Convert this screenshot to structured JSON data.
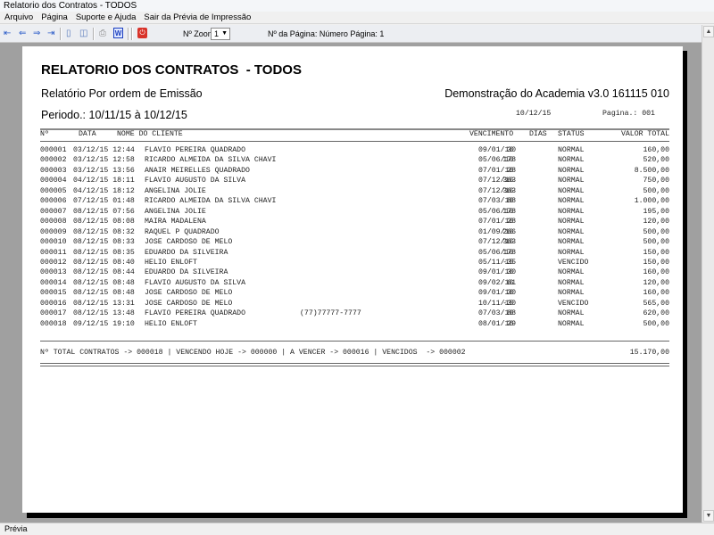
{
  "window": {
    "title": "Relatorio dos Contratos  - TODOS"
  },
  "menu": [
    "Arquivo",
    "Página",
    "Suporte e Ajuda",
    "Sair da Prévia de Impressão"
  ],
  "toolbar": {
    "zoom_label": "Nº Zoom",
    "zoom_value": "1",
    "page_info": "Nº da Página: Número Página: 1"
  },
  "report": {
    "title": "RELATORIO DOS CONTRATOS  - TODOS",
    "subtitle": "Relatório Por ordem de Emissão",
    "company": "Demonstração do Academia v3.0 161115 010",
    "period": "Periodo.: 10/11/15 à 10/12/15",
    "date": "10/12/15",
    "page": "Pagina.: 001",
    "headers": {
      "num": "Nº",
      "data": "DATA",
      "nome": "NOME DO CLIENTE",
      "venc": "VENCIMENTO",
      "dias": "DIAS",
      "status": "STATUS",
      "valor": "VALOR TOTAL"
    },
    "rows": [
      [
        "000001",
        "03/12/15 12:44",
        "FLAVIO PEREIRA QUADRADO",
        "",
        "09/01/16",
        "30",
        "NORMAL",
        "160,00"
      ],
      [
        "000002",
        "03/12/15 12:58",
        "RICARDO ALMEIDA DA SILVA CHAVI",
        "",
        "05/06/16",
        "178",
        "NORMAL",
        "520,00"
      ],
      [
        "000003",
        "03/12/15 13:56",
        "ANAIR MEIRELLES QUADRADO",
        "",
        "07/01/16",
        "28",
        "NORMAL",
        "8.500,00"
      ],
      [
        "000004",
        "04/12/15 18:11",
        "FLAVIO AUGUSTO DA SILVA",
        "",
        "07/12/16",
        "363",
        "NORMAL",
        "750,00"
      ],
      [
        "000005",
        "04/12/15 18:12",
        "ANGELINA JOLIE",
        "",
        "07/12/16",
        "363",
        "NORMAL",
        "500,00"
      ],
      [
        "000006",
        "07/12/15 01:48",
        "RICARDO ALMEIDA DA SILVA CHAVI",
        "",
        "07/03/16",
        "88",
        "NORMAL",
        "1.000,00"
      ],
      [
        "000007",
        "08/12/15 07:56",
        "ANGELINA JOLIE",
        "",
        "05/06/16",
        "178",
        "NORMAL",
        "195,00"
      ],
      [
        "000008",
        "08/12/15 08:08",
        "MAIRA MADALENA",
        "",
        "07/01/16",
        "28",
        "NORMAL",
        "120,00"
      ],
      [
        "000009",
        "08/12/15 08:32",
        "RAQUEL P QUADRADO",
        "",
        "01/09/16",
        "266",
        "NORMAL",
        "500,00"
      ],
      [
        "000010",
        "08/12/15 08:33",
        "JOSE CARDOSO DE MELO",
        "",
        "07/12/16",
        "363",
        "NORMAL",
        "500,00"
      ],
      [
        "000011",
        "08/12/15 08:35",
        "EDUARDO DA SILVEIRA",
        "",
        "05/06/16",
        "178",
        "NORMAL",
        "150,00"
      ],
      [
        "000012",
        "08/12/15 08:40",
        "HELIO ENLOFT",
        "",
        "05/11/15",
        "-35",
        "VENCIDO",
        "150,00"
      ],
      [
        "000013",
        "08/12/15 08:44",
        "EDUARDO DA SILVEIRA",
        "",
        "09/01/16",
        "30",
        "NORMAL",
        "160,00"
      ],
      [
        "000014",
        "08/12/15 08:48",
        "FLAVIO AUGUSTO DA SILVA",
        "",
        "09/02/16",
        "61",
        "NORMAL",
        "120,00"
      ],
      [
        "000015",
        "08/12/15 08:48",
        "JOSE CARDOSO DE MELO",
        "",
        "09/01/16",
        "30",
        "NORMAL",
        "160,00"
      ],
      [
        "000016",
        "08/12/15 13:31",
        "JOSE CARDOSO DE MELO",
        "",
        "10/11/15",
        "-30",
        "VENCIDO",
        "565,00"
      ],
      [
        "000017",
        "08/12/15 13:48",
        "FLAVIO PEREIRA QUADRADO",
        "(77)77777-7777",
        "07/03/16",
        "88",
        "NORMAL",
        "620,00"
      ],
      [
        "000018",
        "09/12/15 19:10",
        "HELIO ENLOFT",
        "",
        "08/01/16",
        "29",
        "NORMAL",
        "500,00"
      ]
    ],
    "summary": "Nº TOTAL CONTRATOS -> 000018 | VENCENDO HOJE -> 000000 | A VENCER -> 000016 | VENCIDOS  -> 000002",
    "total": "15.170,00"
  },
  "status": "Prévia"
}
